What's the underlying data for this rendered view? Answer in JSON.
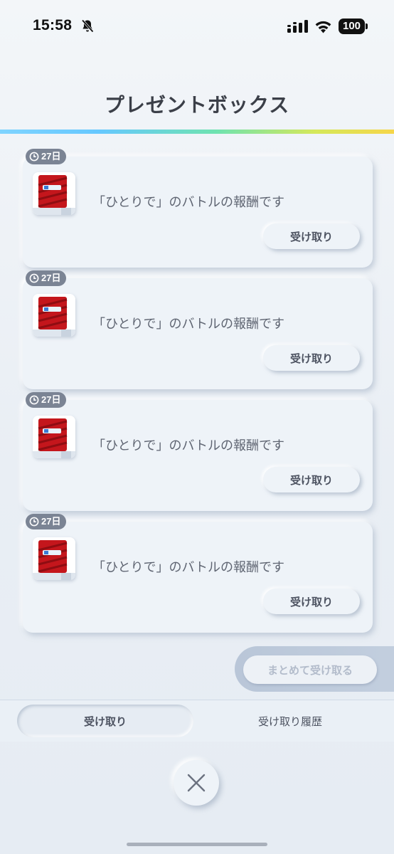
{
  "status_bar": {
    "time": "15:58",
    "battery": "100"
  },
  "header": {
    "title": "プレゼントボックス"
  },
  "cards": [
    {
      "days": "27日",
      "message": "「ひとりで」のバトルの報酬です",
      "button": "受け取り"
    },
    {
      "days": "27日",
      "message": "「ひとりで」のバトルの報酬です",
      "button": "受け取り"
    },
    {
      "days": "27日",
      "message": "「ひとりで」のバトルの報酬です",
      "button": "受け取り"
    },
    {
      "days": "27日",
      "message": "「ひとりで」のバトルの報酬です",
      "button": "受け取り"
    }
  ],
  "bulk_receive_label": "まとめて受け取る",
  "tabs": {
    "receive": "受け取り",
    "history": "受け取り履歴"
  },
  "icons": {
    "bell": "bell-slash-icon",
    "signal": "cellular-signal-icon",
    "wifi": "wifi-icon",
    "battery": "battery-icon",
    "clock": "clock-icon",
    "item": "reward-item-icon",
    "close": "close-icon"
  },
  "colors": {
    "accent_rainbow": [
      "#7fd4ff",
      "#6fe3b0",
      "#f6d64a"
    ],
    "badge": "#7b8494",
    "item_red": "#c4161c"
  }
}
